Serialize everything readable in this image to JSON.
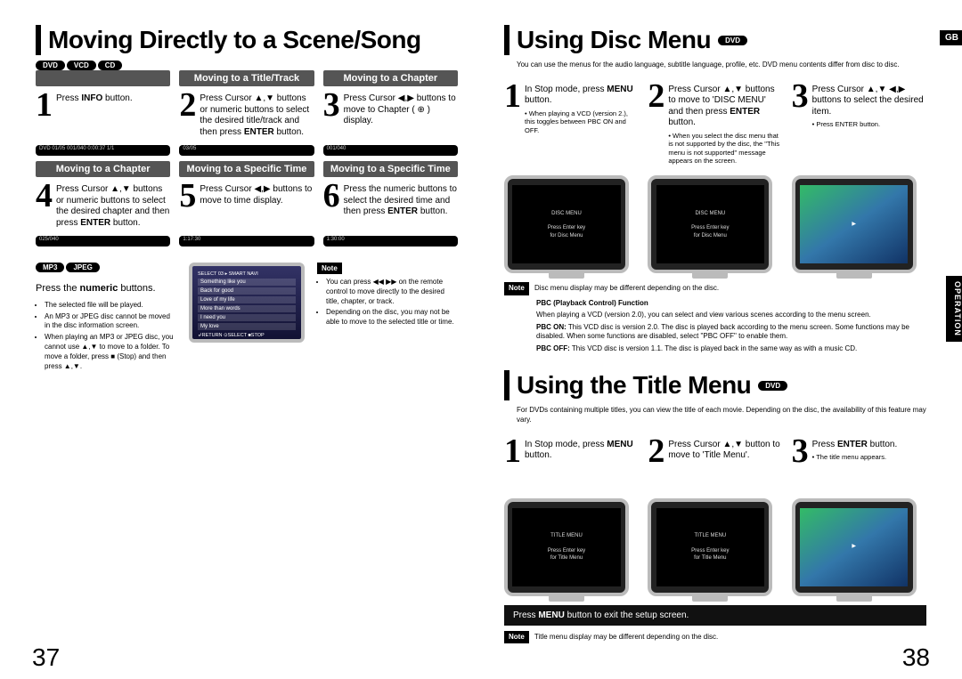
{
  "left": {
    "title": "Moving Directly to a Scene/Song",
    "badges": [
      "DVD",
      "VCD",
      "CD"
    ],
    "row1": [
      {
        "hdr": "",
        "num": "1",
        "txt": "Press <b>INFO</b> button.",
        "disp": "DVD  01/05  001/040  0:00:37  1/1"
      },
      {
        "hdr": "Moving to a Title/Track",
        "num": "2",
        "txt": "Press Cursor ▲,▼ buttons or numeric buttons to select the desired title/track and then press <b>ENTER</b> button.",
        "disp": "03/05"
      },
      {
        "hdr": "Moving to a Chapter",
        "num": "3",
        "txt": "Press Cursor ◀,▶ buttons to move to Chapter ( ⊕ ) display.",
        "disp": "001/040"
      }
    ],
    "row2": [
      {
        "hdr": "Moving to a Chapter",
        "num": "4",
        "txt": "Press Cursor ▲,▼ buttons or numeric buttons to select the desired chapter and then press <b>ENTER</b> button.",
        "disp": "025/040"
      },
      {
        "hdr": "Moving to a Specific Time",
        "num": "5",
        "txt": "Press Cursor ◀,▶ buttons to move to time display.",
        "disp": "1:17:30"
      },
      {
        "hdr": "Moving to a Specific Time",
        "num": "6",
        "txt": "Press the numeric buttons to select the desired time and then press <b>ENTER</b> button.",
        "disp": "1:30:00"
      }
    ],
    "badges2": [
      "MP3",
      "JPEG"
    ],
    "numeric_label": "Press the <b>numeric</b> buttons.",
    "bullets": [
      "The selected file will be played.",
      "An MP3 or JPEG disc cannot be moved in the disc information screen.",
      "When playing an MP3 or JPEG disc, you cannot use ▲,▼ to move to a folder. To move a folder, press ■ (Stop) and then press ▲,▼."
    ],
    "list_title": "SELECT    03           ▸ SMART NAVI",
    "list_items": [
      "Something like you",
      "Back for good",
      "Love of my life",
      "More than words",
      "I need you",
      "My love"
    ],
    "list_footer": "↲RETURN   ⊙SELECT   ■STOP",
    "note_label": "Note",
    "note_items": [
      "You can press ◀◀ ▶▶ on the remote control to move directly to the desired title, chapter, or track.",
      "Depending on the disc, you may not be able to move to the selected title or time."
    ],
    "pagenum": "37"
  },
  "right": {
    "gb": "GB",
    "operation": "OPERATION",
    "disc": {
      "title": "Using Disc Menu",
      "badge": "DVD",
      "sub": "You can use the menus for the audio language, subtitle language, profile, etc. DVD menu contents differ from disc to disc.",
      "steps": [
        {
          "num": "1",
          "txt": "In Stop mode, press <b>MENU</b> button.",
          "sub": "When playing a VCD (version 2.), this toggles between PBC ON and OFF."
        },
        {
          "num": "2",
          "txt": "Press Cursor ▲,▼ buttons to move to 'DISC MENU' and then press <b>ENTER</b> button.",
          "sub": "When you select the disc menu that is not supported by the disc, the \"This menu is not supported\" message appears on the screen."
        },
        {
          "num": "3",
          "txt": "Press Cursor ▲,▼ ◀,▶ buttons to select the desired item.",
          "sub": "Press ENTER button."
        }
      ],
      "tv1": "DISC MENU\\n\\nPress Enter key\\nfor Disc Menu",
      "note": "Note",
      "notelines": [
        "Disc menu display may be different depending on the disc."
      ],
      "pbc_title": "PBC (Playback Control) Function",
      "pbc_intro": "When playing a VCD (version 2.0), you can select and view various scenes according to the menu screen.",
      "pbc_on": "<b>PBC ON:</b> This VCD disc is version 2.0. The disc is played back according to the menu screen. Some functions may be disabled. When some functions are disabled, select \"PBC OFF\" to enable them.",
      "pbc_off": "<b>PBC OFF:</b> This VCD disc is version 1.1. The disc is played back in the same way as with a music CD."
    },
    "titleMenu": {
      "title": "Using the Title Menu",
      "badge": "DVD",
      "sub": "For DVDs containing multiple titles, you can view the title of each movie. Depending on the disc, the availability of this feature may vary.",
      "steps": [
        {
          "num": "1",
          "txt": "In Stop mode, press <b>MENU</b> button."
        },
        {
          "num": "2",
          "txt": "Press Cursor ▲,▼ button to move to 'Title Menu'."
        },
        {
          "num": "3",
          "txt": "Press <b>ENTER</b> button.",
          "sub": "The title menu appears."
        }
      ],
      "tv": "TITLE MENU\\n\\nPress Enter key\\nfor Title Menu",
      "bar": "Press <b>MENU</b> button to exit the setup screen.",
      "note": "Note",
      "noteline": "Title menu display may be different depending on the disc."
    },
    "pagenum": "38"
  }
}
